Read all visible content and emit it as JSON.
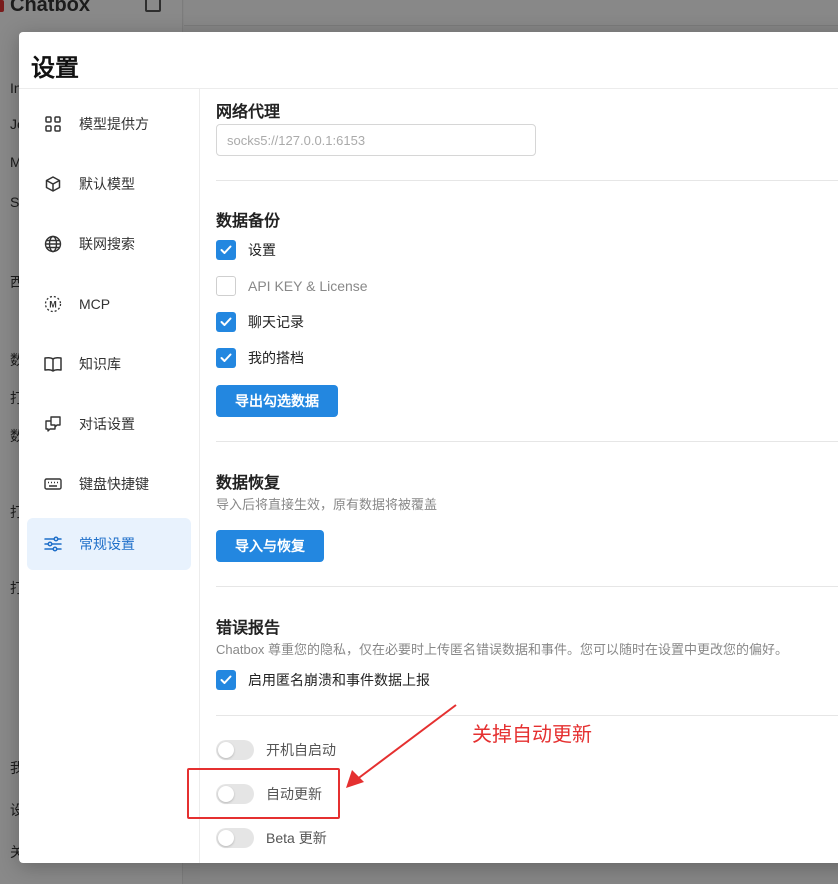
{
  "background": {
    "brand": "Chatbox",
    "letters": [
      "In",
      "Je",
      "M",
      "S",
      "西",
      "数",
      "打",
      "数",
      "打",
      "打",
      "我",
      "设",
      "关"
    ]
  },
  "modal": {
    "title": "设置"
  },
  "nav": {
    "items": [
      {
        "label": "模型提供方",
        "icon": "grid-icon"
      },
      {
        "label": "默认模型",
        "icon": "cube-icon"
      },
      {
        "label": "联网搜索",
        "icon": "globe-icon"
      },
      {
        "label": "MCP",
        "icon": "mcp-icon"
      },
      {
        "label": "知识库",
        "icon": "book-icon"
      },
      {
        "label": "对话设置",
        "icon": "chat-icon"
      },
      {
        "label": "键盘快捷键",
        "icon": "keyboard-icon"
      },
      {
        "label": "常规设置",
        "icon": "sliders-icon",
        "active": true
      }
    ]
  },
  "proxy": {
    "title": "网络代理",
    "placeholder": "socks5://127.0.0.1:6153"
  },
  "backup": {
    "title": "数据备份",
    "options": [
      {
        "label": "设置",
        "checked": true
      },
      {
        "label": "API KEY & License",
        "checked": false
      },
      {
        "label": "聊天记录",
        "checked": true
      },
      {
        "label": "我的搭档",
        "checked": true
      }
    ],
    "button": "导出勾选数据"
  },
  "restore": {
    "title": "数据恢复",
    "desc": "导入后将直接生效，原有数据将被覆盖",
    "button": "导入与恢复"
  },
  "error_report": {
    "title": "错误报告",
    "desc": "Chatbox 尊重您的隐私，仅在必要时上传匿名错误数据和事件。您可以随时在设置中更改您的偏好。",
    "option": {
      "label": "启用匿名崩溃和事件数据上报",
      "checked": true
    }
  },
  "toggles": [
    {
      "label": "开机自启动",
      "on": false
    },
    {
      "label": "自动更新",
      "on": false
    },
    {
      "label": "Beta 更新",
      "on": false
    }
  ],
  "annotation": {
    "text": "关掉自动更新",
    "color": "#e53030"
  },
  "colors": {
    "accent": "#2387e0",
    "active_nav_bg": "#e8f2fd"
  }
}
